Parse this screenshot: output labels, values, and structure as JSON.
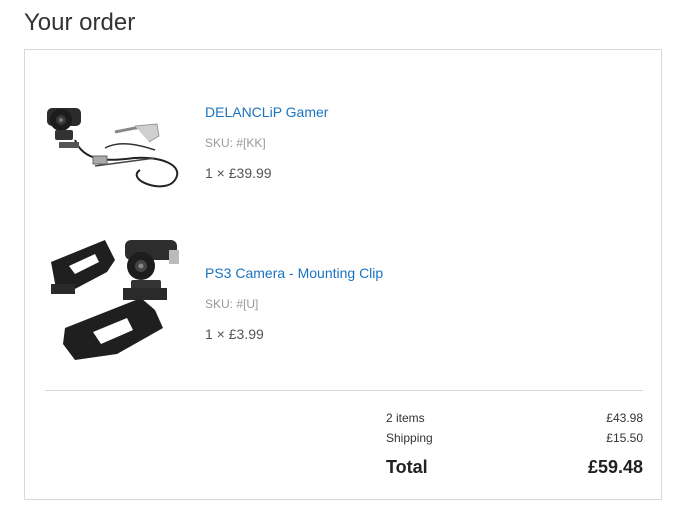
{
  "page": {
    "title": "Your order"
  },
  "items": [
    {
      "name": "DELANCLiP Gamer",
      "sku": "SKU: #[KK]",
      "qty_price": "1 × £39.99",
      "image": "ps-eye-camera-with-cable-image"
    },
    {
      "name": "PS3 Camera - Mounting Clip",
      "sku": "SKU: #[U]",
      "qty_price": "1 × £3.99",
      "image": "camera-mounting-clip-image"
    }
  ],
  "summary": {
    "items_label": "2 items",
    "items_value": "£43.98",
    "shipping_label": "Shipping",
    "shipping_value": "£15.50",
    "total_label": "Total",
    "total_value": "£59.48"
  },
  "colors": {
    "link": "#1a73c1",
    "border": "#d9d9d9",
    "muted_text": "#999999"
  }
}
